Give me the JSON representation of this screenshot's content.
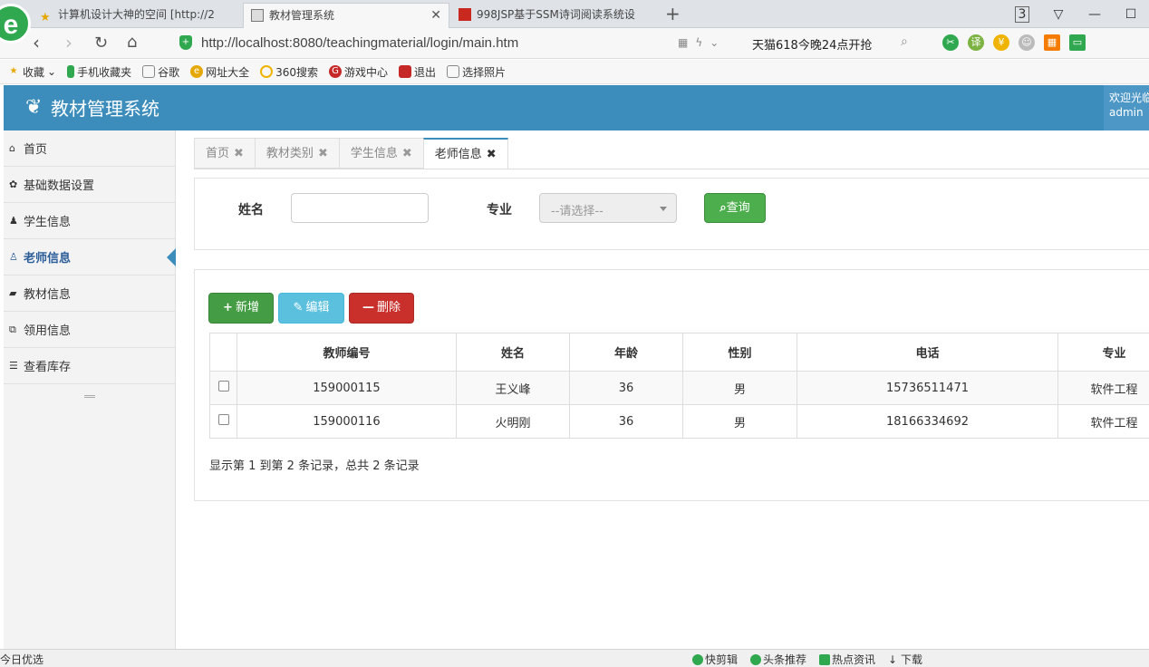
{
  "browser": {
    "logo_letter": "e",
    "tabs": [
      {
        "title": "计算机设计大神的空间 [http://2"
      },
      {
        "title": "教材管理系统"
      },
      {
        "title": "998JSP基于SSM诗词阅读系统设"
      }
    ],
    "new_tab": "+",
    "tab_count": "3",
    "url": "http://localhost:8080/teachingmaterial/login/main.htm",
    "promo": "天猫618今晚24点开抢",
    "bookmarks": [
      "收藏",
      "手机收藏夹",
      "谷歌",
      "网址大全",
      "360搜索",
      "游戏中心",
      "退出",
      "选择照片"
    ]
  },
  "app": {
    "title": "教材管理系统",
    "user_greeting": "欢迎光临",
    "user_name": "admin"
  },
  "sidebar": {
    "items": [
      {
        "label": "首页",
        "icon": "home-icon"
      },
      {
        "label": "基础数据设置",
        "icon": "gear-icon"
      },
      {
        "label": "学生信息",
        "icon": "users-icon"
      },
      {
        "label": "老师信息",
        "icon": "user-icon",
        "active": true
      },
      {
        "label": "教材信息",
        "icon": "book-icon"
      },
      {
        "label": "领用信息",
        "icon": "clone-icon"
      },
      {
        "label": "查看库存",
        "icon": "list-icon"
      }
    ]
  },
  "content_tabs": [
    {
      "label": "首页"
    },
    {
      "label": "教材类别"
    },
    {
      "label": "学生信息"
    },
    {
      "label": "老师信息",
      "active": true
    }
  ],
  "search": {
    "name_label": "姓名",
    "name_value": "",
    "major_label": "专业",
    "major_placeholder": "--请选择--",
    "query_button": "查询"
  },
  "toolbar": {
    "add_label": "新增",
    "edit_label": "编辑",
    "delete_label": "删除"
  },
  "table": {
    "columns": [
      "教师编号",
      "姓名",
      "年龄",
      "性别",
      "电话",
      "专业"
    ],
    "rows": [
      [
        "159000115",
        "王义峰",
        "36",
        "男",
        "15736511471",
        "软件工程"
      ],
      [
        "159000116",
        "火明刚",
        "36",
        "男",
        "18166334692",
        "软件工程"
      ]
    ],
    "pagination": "显示第 1 到第 2 条记录，总共 2 条记录"
  },
  "statusbar": {
    "left": "今日优选",
    "items": [
      "快剪辑",
      "头条推荐",
      "热点资讯",
      "下载"
    ]
  },
  "colors": {
    "header": "#3c8dbc",
    "success": "#449d44",
    "info": "#5bc0de",
    "danger": "#c9302c"
  }
}
